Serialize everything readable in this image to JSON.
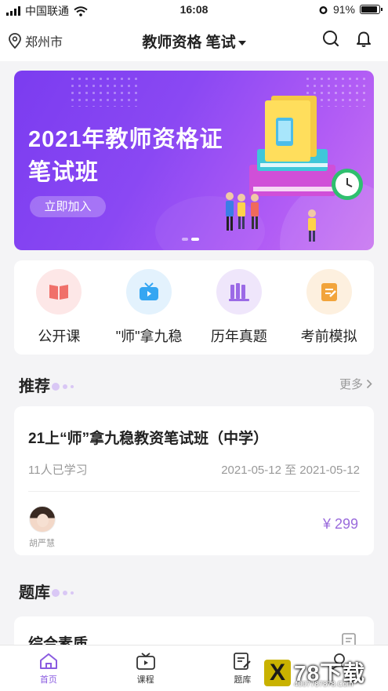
{
  "status_bar": {
    "carrier": "中国联通",
    "time": "16:08",
    "battery": "91%",
    "battery_level": 0.91
  },
  "navbar": {
    "location": "郑州市",
    "title": "教师资格 笔试"
  },
  "banner": {
    "title_line1": "2021年教师资格证",
    "title_line2": "笔试班",
    "cta_label": "立即加入",
    "slide_count": 2,
    "active_slide": 2
  },
  "quick_links": [
    {
      "label": "公开课",
      "icon": "book-icon",
      "bg": "#fde7e7",
      "color": "#f0706a"
    },
    {
      "label": "\"师\"拿九稳",
      "icon": "tv-icon",
      "bg": "#e3f2fd",
      "color": "#35a6f2"
    },
    {
      "label": "历年真题",
      "icon": "library-icon",
      "bg": "#efe6fb",
      "color": "#9b6ae6"
    },
    {
      "label": "考前模拟",
      "icon": "notepad-icon",
      "bg": "#fdf0df",
      "color": "#f2a43b"
    }
  ],
  "recommend": {
    "title": "推荐",
    "more_label": "更多",
    "course": {
      "title": "21上“师”拿九稳教资笔试班（中学）",
      "learners": "11人已学习",
      "dates": "2021-05-12 至 2021-05-12",
      "teacher": "胡严慧",
      "price": "¥ 299"
    }
  },
  "question_bank": {
    "title": "题库",
    "first_item": "综合素质"
  },
  "tabbar": {
    "tabs": [
      {
        "label": "首页",
        "icon": "home-icon",
        "active": true
      },
      {
        "label": "课程",
        "icon": "course-tv-icon",
        "active": false
      },
      {
        "label": "题库",
        "icon": "question-bank-icon",
        "active": false
      },
      {
        "label": "我的",
        "icon": "profile-icon",
        "active": false
      }
    ]
  },
  "watermark": {
    "brand": "78下载",
    "site": "4007787878.Com"
  },
  "colors": {
    "accent": "#8a5be0",
    "banner_start": "#7b3cf0",
    "banner_end": "#c874f0",
    "price": "#9a6bdc"
  }
}
